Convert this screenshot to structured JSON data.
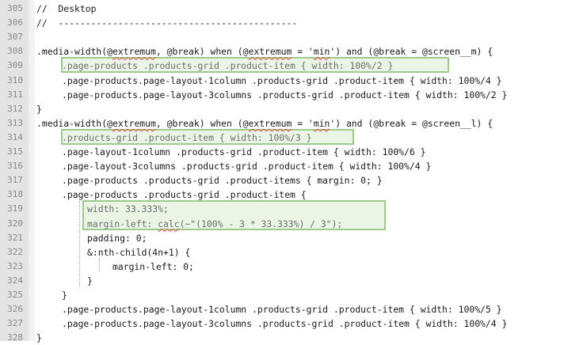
{
  "editor": {
    "lines": [
      {
        "n": "305",
        "indent": 0,
        "text": "//  Desktop"
      },
      {
        "n": "306",
        "indent": 0,
        "text": "//  --------------------------------------------"
      },
      {
        "n": "307",
        "indent": 0,
        "text": ""
      },
      {
        "n": "308",
        "indent": 0,
        "text": ".media-width(@extremum, @break) when (@extremum = 'min') and (@break = @screen__m) {"
      },
      {
        "n": "309",
        "indent": 1,
        "text": ".page-products .products-grid .product-item { width: 100%/2 }",
        "highlight": true
      },
      {
        "n": "310",
        "indent": 1,
        "text": ".page-products.page-layout-1column .products-grid .product-item { width: 100%/4 }"
      },
      {
        "n": "311",
        "indent": 1,
        "text": ".page-products.page-layout-3columns .products-grid .product-item { width: 100%/2 }"
      },
      {
        "n": "312",
        "indent": 0,
        "text": "}"
      },
      {
        "n": "313",
        "indent": 0,
        "text": ".media-width(@extremum, @break) when (@extremum = 'min') and (@break = @screen__l) {"
      },
      {
        "n": "314",
        "indent": 1,
        "text": ".products-grid .product-item { width: 100%/3 }",
        "highlight": true
      },
      {
        "n": "315",
        "indent": 1,
        "text": ".page-layout-1column .products-grid .product-item { width: 100%/6 }"
      },
      {
        "n": "316",
        "indent": 1,
        "text": ".page-layout-3columns .products-grid .product-item { width: 100%/4 }"
      },
      {
        "n": "317",
        "indent": 1,
        "text": ".page-products .products-grid .product-items { margin: 0; }"
      },
      {
        "n": "318",
        "indent": 1,
        "text": ".page-products .products-grid .product-item {"
      },
      {
        "n": "319",
        "indent": 2,
        "text": "width: 33.333%;",
        "highlight_block": true
      },
      {
        "n": "320",
        "indent": 2,
        "text": "margin-left: calc(~\"(100% - 3 * 33.333%) / 3\");",
        "highlight_block": true
      },
      {
        "n": "321",
        "indent": 2,
        "text": "padding: 0;"
      },
      {
        "n": "322",
        "indent": 2,
        "text": "&:nth-child(4n+1) {"
      },
      {
        "n": "323",
        "indent": 3,
        "text": "margin-left: 0;"
      },
      {
        "n": "324",
        "indent": 2,
        "text": "}"
      },
      {
        "n": "325",
        "indent": 1,
        "text": "}"
      },
      {
        "n": "326",
        "indent": 1,
        "text": ".page-products.page-layout-1column .products-grid .product-item { width: 100%/5 }"
      },
      {
        "n": "327",
        "indent": 1,
        "text": ".page-products.page-layout-3columns .products-grid .product-item { width: 100%/4 }"
      },
      {
        "n": "328",
        "indent": 0,
        "text": "}"
      }
    ],
    "colors": {
      "gutter": "#e4e4e4",
      "highlight_border": "#9fca8e",
      "misspelling": "#e05050"
    }
  }
}
